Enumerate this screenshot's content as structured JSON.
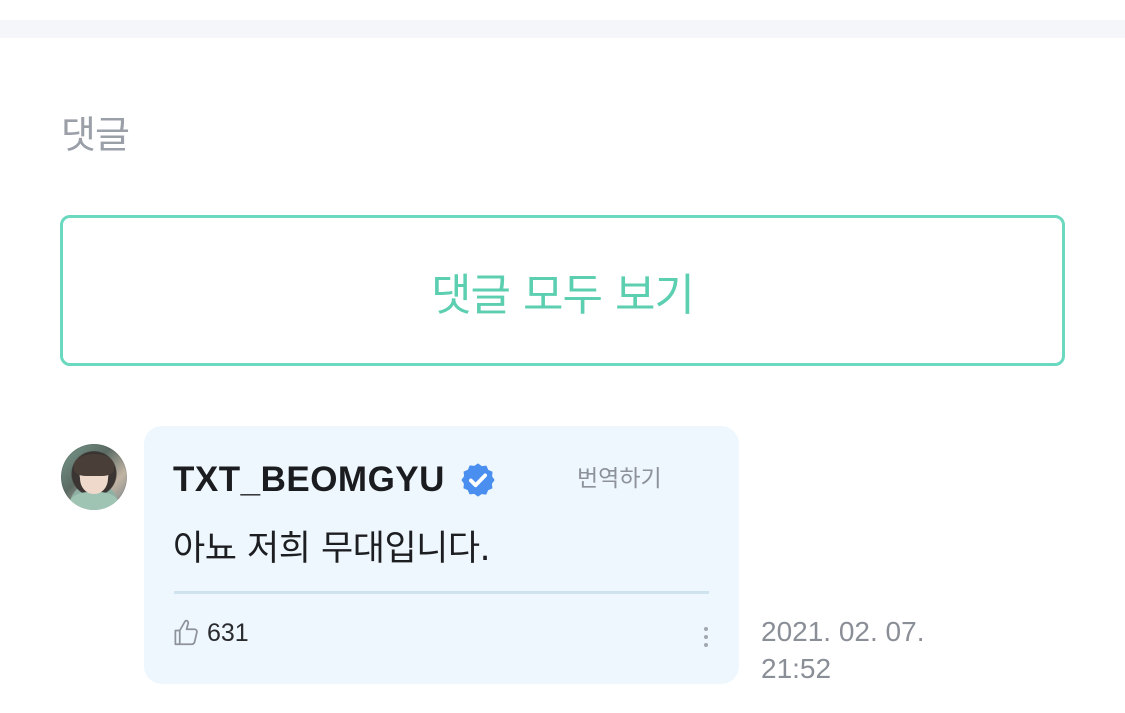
{
  "comments_section": {
    "title": "댓글",
    "view_all_label": "댓글 모두 보기"
  },
  "comment": {
    "author": "TXT_BEOMGYU",
    "verified": true,
    "translate_label": "번역하기",
    "text": "아뇨 저희 무대입니다.",
    "like_count": "631",
    "date": "2021. 02. 07.",
    "time": "21:52"
  },
  "colors": {
    "accent": "#5ccfb1",
    "card_background": "#eef7fd",
    "verified_badge": "#4a8ff0"
  },
  "icons": {
    "verified": "verified-badge-icon",
    "like": "thumbs-up-icon",
    "more": "more-vertical-icon"
  }
}
